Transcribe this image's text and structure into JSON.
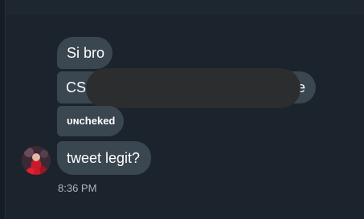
{
  "conversation": {
    "messages": [
      {
        "text": "Si bro"
      },
      {
        "text_start": "CS",
        "text_end": "e"
      },
      {
        "text": "ᴜɴcheked"
      },
      {
        "text": "tweet legit?"
      }
    ],
    "timestamp": "8:36 PM"
  },
  "colors": {
    "background": "#1b232c",
    "bubble": "#3a4650",
    "text": "#ffffff",
    "timestamp": "#aeb6bd",
    "redaction": "#2b2d2e"
  },
  "icons": {
    "avatar": "user-avatar-icon"
  }
}
